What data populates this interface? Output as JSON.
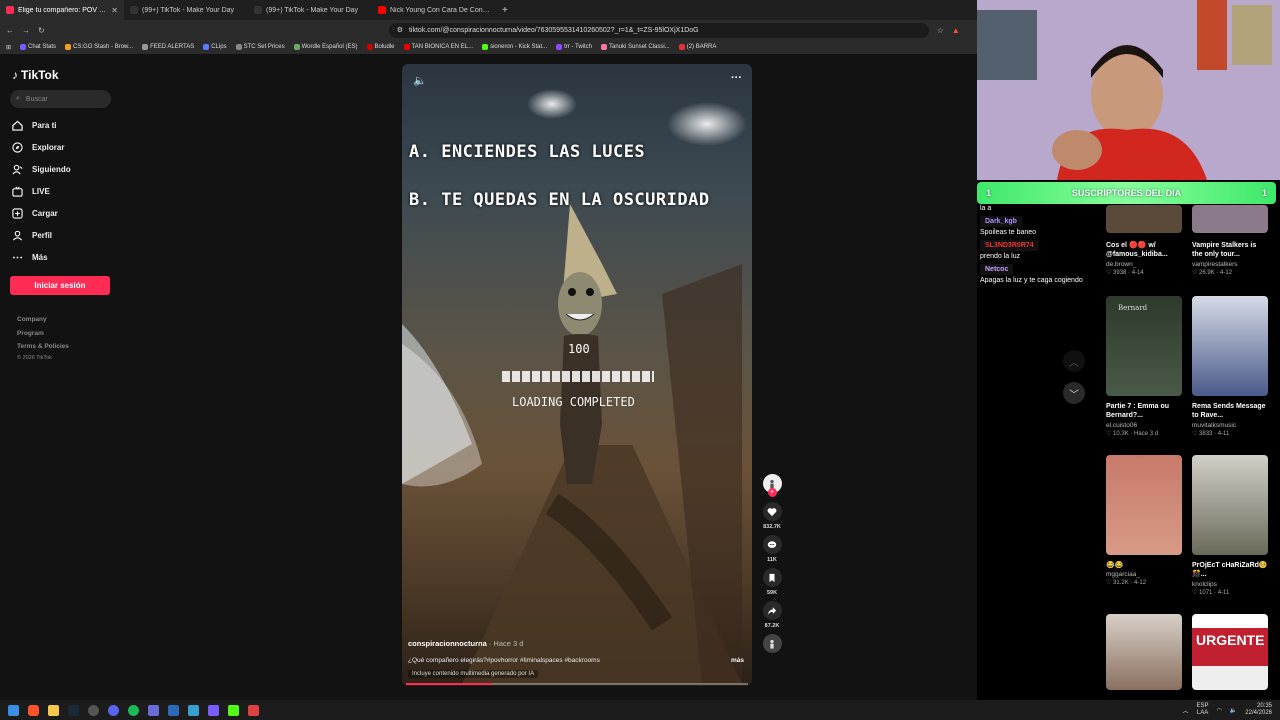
{
  "tabs": [
    {
      "title": "Elige tu compañero: POV Horror",
      "color": "#fe2c55",
      "active": true
    },
    {
      "title": "(99+) TikTok - Make Your Day",
      "color": "#111"
    },
    {
      "title": "(99+) TikTok - Make Your Day",
      "color": "#111"
    },
    {
      "title": "Nick Young Con Cara De Confundido",
      "color": "#ff0000"
    }
  ],
  "url": "tiktok.com/@conspiracionnocturna/video/7630595531410260502?_r=1&_t=ZS-95lOXjX1DoG",
  "bookmarks": [
    {
      "label": "Chat Stats",
      "color": "#7b5cff"
    },
    {
      "label": "CS:GO Stash - Brow...",
      "color": "#f0a020"
    },
    {
      "label": "FEED ALERTAS",
      "color": "#999"
    },
    {
      "label": "CLips",
      "color": "#5a7cff"
    },
    {
      "label": "STC Set Prices",
      "color": "#888"
    },
    {
      "label": "Wordle Español (ES)",
      "color": "#6aaa64"
    },
    {
      "label": "Boludle",
      "color": "#c00"
    },
    {
      "label": "TAN BIONICA EN EL...",
      "color": "#e00"
    },
    {
      "label": "sioneron - Kick Stat...",
      "color": "#53fc18"
    },
    {
      "label": "trr - Twitch",
      "color": "#9146ff"
    },
    {
      "label": "Tanuki Sunset Classi...",
      "color": "#f7a"
    },
    {
      "label": "(2) BARRA",
      "color": "#d33"
    }
  ],
  "sidebar": {
    "logo": "TikTok",
    "search_placeholder": "Buscar",
    "nav": [
      {
        "label": "Para ti",
        "icon": "home-icon"
      },
      {
        "label": "Explorar",
        "icon": "compass-icon"
      },
      {
        "label": "Siguiendo",
        "icon": "following-icon"
      },
      {
        "label": "LIVE",
        "icon": "live-icon"
      },
      {
        "label": "Cargar",
        "icon": "upload-icon"
      },
      {
        "label": "Perfil",
        "icon": "profile-icon"
      },
      {
        "label": "Más",
        "icon": "more-icon"
      }
    ],
    "login": "Iniciar sesión",
    "footer": [
      "Company",
      "Program",
      "Terms & Policies",
      "© 2026 TikTok"
    ]
  },
  "video": {
    "line_a": "A. ENCIENDES LAS LUCES",
    "line_b": "B. TE QUEDAS EN LA OSCURIDAD",
    "loading_number": "100",
    "loading_text": "LOADING COMPLETED",
    "author": "conspiracionnocturna",
    "time": " · Hace 3 d",
    "description": "¿Qué compañero elegirás?#povhorror #liminalspaces #backrooms",
    "more": "más",
    "ai_label": "Incluye contenido multimedia generado por IA",
    "progress": 0.25
  },
  "actions": {
    "likes": "832.7K",
    "comments": "11K",
    "saves": "59K",
    "shares": "87.2K"
  },
  "stream": {
    "subs_banner": "SUSCRIPTORES DEL DIA",
    "subs_left": "1",
    "subs_right": "1",
    "chat": [
      {
        "user": "",
        "text": "la a",
        "color": "#fff"
      },
      {
        "user": "Dark_kgb",
        "text": "Spoileas te baneo",
        "color": "#b08cff"
      },
      {
        "user": "SL3ND3R0R74",
        "text": "prendo la luz",
        "color": "#e33"
      },
      {
        "user": "Netcoc",
        "text": "Apagas la luz y te caga cogiendo",
        "color": "#c9a0ff"
      }
    ]
  },
  "suggestions": [
    {
      "title": "Cos el 🔴🔴 w/ @famous_kidiba...",
      "author": "de.brown_",
      "meta": "♡ 3938 · 4-14",
      "color": "#7a6a5a"
    },
    {
      "title": "Vampire Stalkers is the only tour...",
      "author": "vampirestalkers",
      "meta": "♡ 26.9K · 4-12",
      "color": "#9a8a9a"
    },
    {
      "title": "Partie 7 : Emma ou Bernard?...",
      "author": "el.cuisto06",
      "meta": "♡ 10.3K · Hace 3 d",
      "color": "#3b4a3a"
    },
    {
      "title": "Rema Sends Message to Rave...",
      "author": "muvitalksmusic",
      "meta": "♡ 3833 · 4-11",
      "color": "#5a6a8a"
    },
    {
      "title": "😂😂",
      "author": "mggarciaa_",
      "meta": "♡ 31.2K · 4-12",
      "color": "#c77a6a"
    },
    {
      "title": "PrOjEcT cHaRiZaRd🥺🎊...",
      "author": "knolclips",
      "meta": "♡ 1071 · 4-11",
      "color": "#7a7a6a"
    },
    {
      "title": "",
      "author": "",
      "meta": "",
      "color": "#8a7060"
    },
    {
      "title": "",
      "author": "",
      "meta": "",
      "color": "#c02030"
    }
  ],
  "suggestion_overlays": [
    "Bernard",
    "URGENTE"
  ],
  "taskbar": {
    "lang": "ESP\nLAA",
    "time": "20:35",
    "date": "22/4/2026"
  }
}
